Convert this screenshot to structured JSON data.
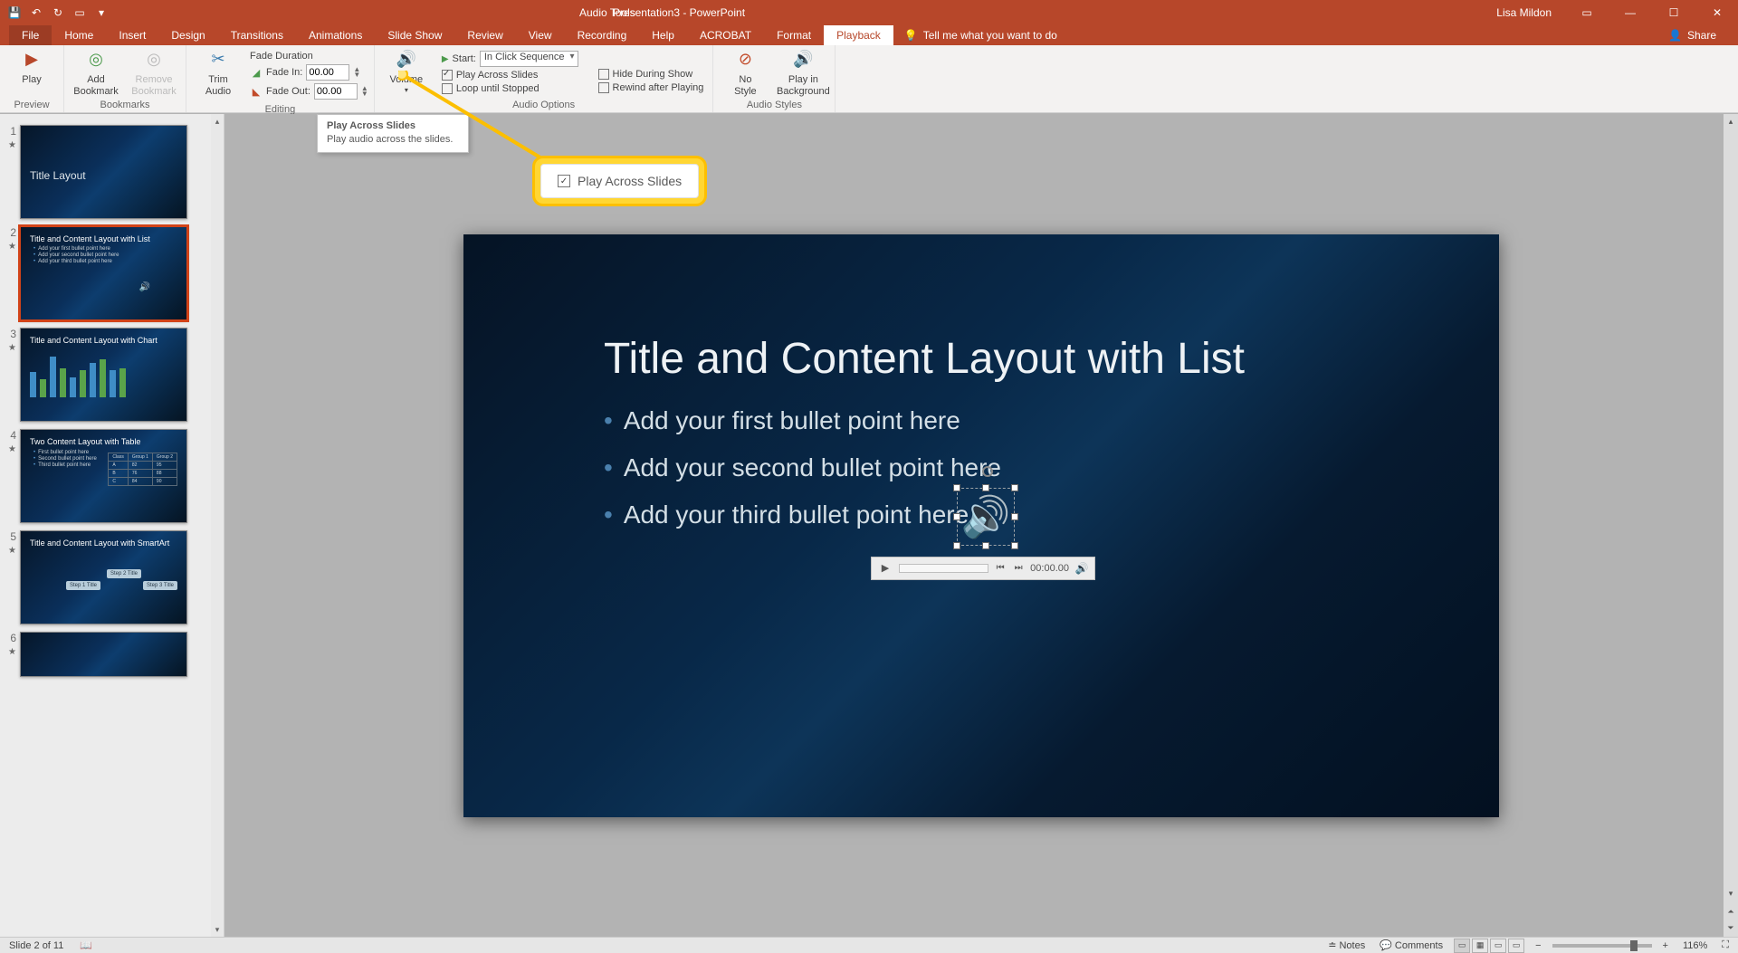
{
  "titlebar": {
    "doc_title": "Presentation3 - PowerPoint",
    "tools_title": "Audio Tools",
    "user": "Lisa Mildon"
  },
  "tabs": {
    "file": "File",
    "home": "Home",
    "insert": "Insert",
    "design": "Design",
    "transitions": "Transitions",
    "animations": "Animations",
    "slideshow": "Slide Show",
    "review": "Review",
    "view": "View",
    "recording": "Recording",
    "help": "Help",
    "acrobat": "ACROBAT",
    "format": "Format",
    "playback": "Playback",
    "tellme": "Tell me what you want to do",
    "share": "Share"
  },
  "ribbon": {
    "preview": {
      "play": "Play",
      "label": "Preview"
    },
    "bookmarks": {
      "add": "Add\nBookmark",
      "remove": "Remove\nBookmark",
      "label": "Bookmarks"
    },
    "editing": {
      "trim": "Trim\nAudio",
      "fade_title": "Fade Duration",
      "fade_in": "Fade In:",
      "fade_out": "Fade Out:",
      "val": "00.00",
      "label": "Editing"
    },
    "audio_options": {
      "volume": "Volume",
      "start": "Start:",
      "start_val": "In Click Sequence",
      "play_across": "Play Across Slides",
      "loop": "Loop until Stopped",
      "hide": "Hide During Show",
      "rewind": "Rewind after Playing",
      "label": "Audio Options"
    },
    "audio_styles": {
      "no_style": "No\nStyle",
      "play_bg": "Play in\nBackground",
      "label": "Audio Styles"
    }
  },
  "tooltip": {
    "title": "Play Across Slides",
    "body": "Play audio across the slides."
  },
  "callout": {
    "label": "Play Across Slides"
  },
  "slidepanel": {
    "thumbs": [
      {
        "num": "1",
        "title": "Title Layout"
      },
      {
        "num": "2",
        "title": "Title and Content Layout with List",
        "b1": "Add your first bullet point here",
        "b2": "Add your second bullet point here",
        "b3": "Add your third bullet point here"
      },
      {
        "num": "3",
        "title": "Title and Content Layout with Chart"
      },
      {
        "num": "4",
        "title": "Two Content Layout with Table",
        "b1": "First bullet point here",
        "b2": "Second bullet point here",
        "b3": "Third bullet point here"
      },
      {
        "num": "5",
        "title": "Title and Content Layout with SmartArt",
        "s1": "Step 1 Title",
        "s2": "Step 2 Title",
        "s3": "Step 3 Title"
      },
      {
        "num": "6",
        "title": ""
      }
    ]
  },
  "slide": {
    "title": "Title and Content Layout with List",
    "b1": "Add your first bullet point here",
    "b2": "Add your second bullet point here",
    "b3": "Add your third bullet point here",
    "time": "00:00.00"
  },
  "status": {
    "slide": "Slide 2 of 11",
    "notes": "Notes",
    "comments": "Comments",
    "zoom": "116%"
  }
}
